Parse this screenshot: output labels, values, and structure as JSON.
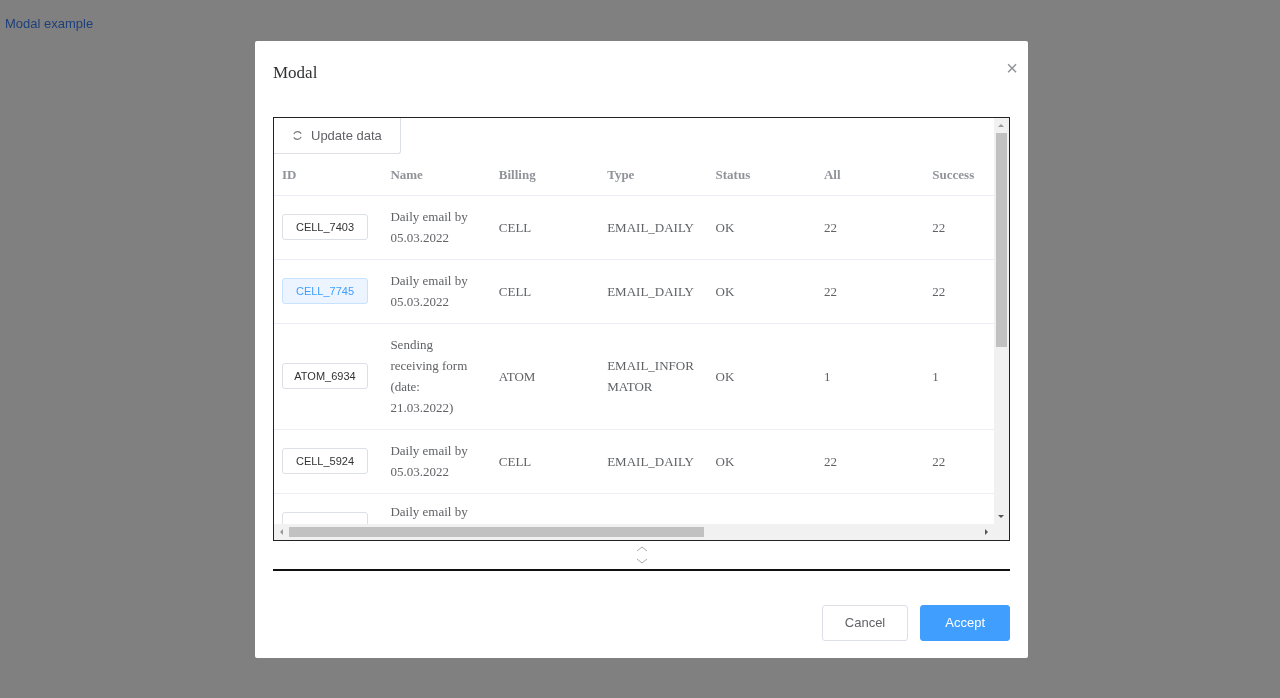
{
  "page_link": "Modal example",
  "modal": {
    "title": "Modal",
    "close": "×",
    "toolbar": {
      "button": "Update data"
    },
    "table": {
      "columns": [
        "ID",
        "Name",
        "Billing",
        "Type",
        "Status",
        "All",
        "Success"
      ],
      "rows": [
        {
          "id": "CELL_7403",
          "selected": false,
          "name": "Daily email by 05.03.2022",
          "billing": "CELL",
          "type": "EMAIL_DAILY",
          "status": "OK",
          "all": "22",
          "success": "22"
        },
        {
          "id": "CELL_7745",
          "selected": true,
          "name": "Daily email by 05.03.2022",
          "billing": "CELL",
          "type": "EMAIL_DAILY",
          "status": "OK",
          "all": "22",
          "success": "22"
        },
        {
          "id": "ATOM_6934",
          "selected": false,
          "name": "Sending receiving form (date: 21.03.2022)",
          "billing": "ATOM",
          "type": "EMAIL_INFOR MATOR",
          "status": "OK",
          "all": "1",
          "success": "1"
        },
        {
          "id": "CELL_5924",
          "selected": false,
          "name": "Daily email by 05.03.2022",
          "billing": "CELL",
          "type": "EMAIL_DAILY",
          "status": "OK",
          "all": "22",
          "success": "22"
        },
        {
          "selected": false,
          "name": "Daily email by"
        }
      ]
    },
    "buttons": [
      {
        "label": "Cancel",
        "kind": "secondary"
      },
      {
        "label": "Accept",
        "kind": "primary"
      }
    ]
  }
}
